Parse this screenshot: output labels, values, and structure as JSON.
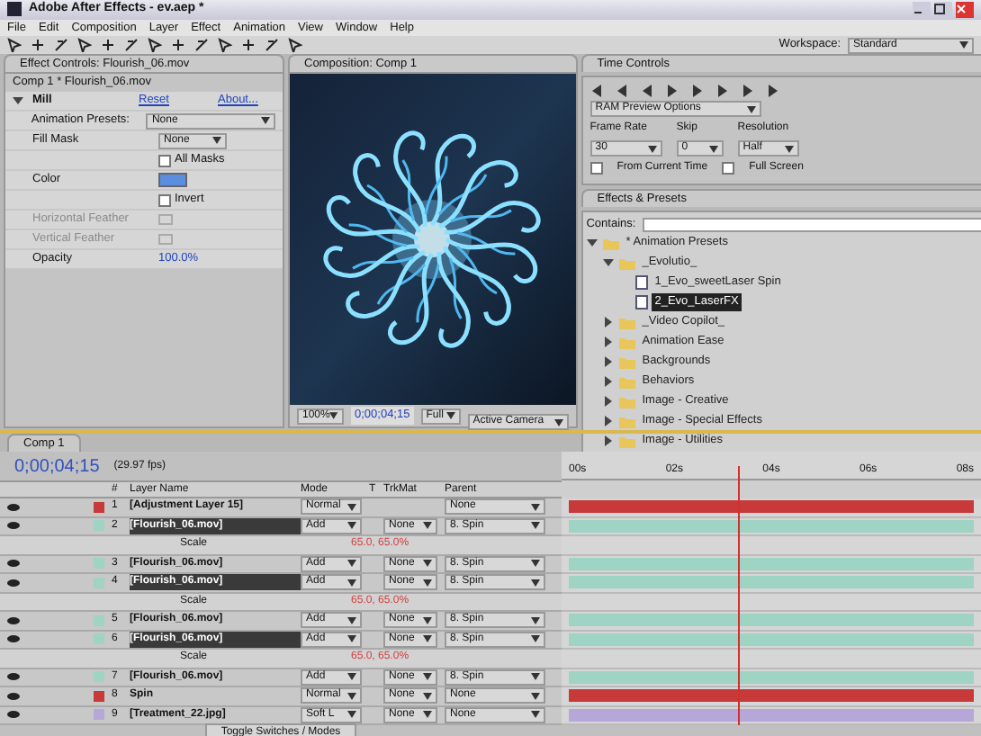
{
  "window": {
    "title": "Adobe After Effects - ev.aep *"
  },
  "menu": [
    "File",
    "Edit",
    "Composition",
    "Layer",
    "Effect",
    "Animation",
    "View",
    "Window",
    "Help"
  ],
  "workspace": {
    "label": "Workspace:",
    "value": "Standard"
  },
  "effect_controls": {
    "tab": "Effect Controls: Flourish_06.mov",
    "header": "Comp 1 * Flourish_06.mov",
    "effect": {
      "name": "Mill",
      "reset": "Reset",
      "about": "About..."
    },
    "properties": [
      {
        "kind": "dropdown",
        "label": "Animation Presets:",
        "value": "None"
      },
      {
        "kind": "dropdown",
        "label": "Fill Mask",
        "value": "None"
      },
      {
        "kind": "checkbox",
        "label": "All Masks",
        "checked": false
      },
      {
        "kind": "color",
        "label": "Color",
        "color": "#5b8ee0"
      },
      {
        "kind": "checkbox",
        "label": "Invert",
        "checked": false
      },
      {
        "kind": "value",
        "label": "Horizontal Feather",
        "disabled": true
      },
      {
        "kind": "value",
        "label": "Vertical Feather",
        "disabled": true
      },
      {
        "kind": "value",
        "label": "Opacity",
        "value": "100.0%"
      }
    ]
  },
  "composition": {
    "tab": "Composition: Comp 1",
    "zoom": "100%",
    "time": "0;00;04;15",
    "resolution": "Full",
    "camera": "Active Camera"
  },
  "time_controls": {
    "tab": "Time Controls",
    "options": "RAM Preview Options",
    "frame_rate_label": "Frame Rate",
    "skip_label": "Skip",
    "resolution_label": "Resolution",
    "frame_rate": "30",
    "skip": "0",
    "resolution": "Half",
    "from_current": {
      "label": "From Current Time",
      "checked": false
    },
    "full_screen": {
      "label": "Full Screen",
      "checked": false
    }
  },
  "effects_presets": {
    "tab": "Effects & Presets",
    "search_label": "Contains:",
    "tree": [
      {
        "kind": "folder",
        "label": "* Animation Presets",
        "expanded": true,
        "selected": false,
        "children": [
          {
            "kind": "folder",
            "label": "_Evolutio_",
            "expanded": true,
            "selected": false,
            "children": [
              {
                "kind": "preset",
                "label": "1_Evo_sweetLaser Spin",
                "selected": false
              },
              {
                "kind": "preset",
                "label": "2_Evo_LaserFX",
                "selected": true
              }
            ]
          },
          {
            "kind": "folder",
            "label": "_Video Copilot_",
            "expanded": false,
            "selected": false
          },
          {
            "kind": "folder",
            "label": "Animation Ease",
            "expanded": false,
            "selected": false
          },
          {
            "kind": "folder",
            "label": "Backgrounds",
            "expanded": false,
            "selected": false
          },
          {
            "kind": "folder",
            "label": "Behaviors",
            "expanded": false,
            "selected": false
          },
          {
            "kind": "folder",
            "label": "Image - Creative",
            "expanded": false,
            "selected": false
          },
          {
            "kind": "folder",
            "label": "Image - Special Effects",
            "expanded": false,
            "selected": false
          },
          {
            "kind": "folder",
            "label": "Image - Utilities",
            "expanded": false,
            "selected": false
          }
        ]
      }
    ]
  },
  "timeline": {
    "tab": "Comp 1",
    "time": "0;00;04;15",
    "fps": "(29.97 fps)",
    "columns": [
      "#",
      "Layer Name",
      "Mode",
      "T",
      "TrkMat",
      "Parent"
    ],
    "ruler": [
      "00s",
      "02s",
      "04s",
      "06s",
      "08s"
    ],
    "toggle": "Toggle Switches / Modes",
    "rows": [
      {
        "kind": "layer",
        "num": "1",
        "name": "[Adjustment Layer 15]",
        "mode": "Normal",
        "parent": "None",
        "color": "#c83a3a",
        "selected": false
      },
      {
        "kind": "layer",
        "num": "2",
        "name": "[Flourish_06.mov]",
        "mode": "Add",
        "trkmat": "None",
        "parent": "8. Spin",
        "color": "#9fd3c4",
        "selected": true
      },
      {
        "kind": "property",
        "name": "Scale",
        "value": "65.0, 65.0%"
      },
      {
        "kind": "layer",
        "num": "3",
        "name": "[Flourish_06.mov]",
        "mode": "Add",
        "trkmat": "None",
        "parent": "8. Spin",
        "color": "#9fd3c4",
        "selected": false
      },
      {
        "kind": "layer",
        "num": "4",
        "name": "[Flourish_06.mov]",
        "mode": "Add",
        "trkmat": "None",
        "parent": "8. Spin",
        "color": "#9fd3c4",
        "selected": true
      },
      {
        "kind": "property",
        "name": "Scale",
        "value": "65.0, 65.0%"
      },
      {
        "kind": "layer",
        "num": "5",
        "name": "[Flourish_06.mov]",
        "mode": "Add",
        "trkmat": "None",
        "parent": "8. Spin",
        "color": "#9fd3c4",
        "selected": false
      },
      {
        "kind": "layer",
        "num": "6",
        "name": "[Flourish_06.mov]",
        "mode": "Add",
        "trkmat": "None",
        "parent": "8. Spin",
        "color": "#9fd3c4",
        "selected": true
      },
      {
        "kind": "property",
        "name": "Scale",
        "value": "65.0, 65.0%"
      },
      {
        "kind": "layer",
        "num": "7",
        "name": "[Flourish_06.mov]",
        "mode": "Add",
        "trkmat": "None",
        "parent": "8. Spin",
        "color": "#9fd3c4",
        "selected": false
      },
      {
        "kind": "layer",
        "num": "8",
        "name": "Spin",
        "mode": "Normal",
        "trkmat": "None",
        "parent": "None",
        "color": "#c83a3a",
        "selected": false
      },
      {
        "kind": "layer",
        "num": "9",
        "name": "[Treatment_22.jpg]",
        "mode": "Soft L",
        "trkmat": "None",
        "parent": "None",
        "color": "#b7a6d8",
        "selected": false
      }
    ]
  }
}
